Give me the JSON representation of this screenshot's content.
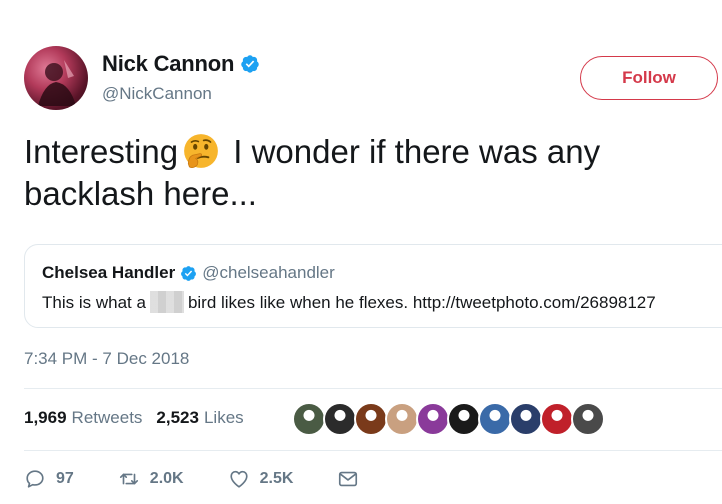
{
  "author": {
    "name": "Nick Cannon",
    "handle": "@NickCannon",
    "verified": true
  },
  "follow": {
    "label": "Follow"
  },
  "tweet": {
    "text_before_emoji": "Interesting",
    "emoji": "thinking-face",
    "text_after_emoji": " I wonder if there was any backlash here..."
  },
  "quote": {
    "name": "Chelsea Handler",
    "handle": "@chelseahandler",
    "verified": true,
    "text_before_blur": "This is what a",
    "text_after_blur": "bird likes like when he flexes.  http://tweetphoto.com/26898127"
  },
  "timestamp": "7:34 PM - 7 Dec 2018",
  "stats": {
    "retweets_count": "1,969",
    "retweets_label": "Retweets",
    "likes_count": "2,523",
    "likes_label": "Likes"
  },
  "likers": [
    {
      "color": "#4a5b44"
    },
    {
      "color": "#2b2b2b"
    },
    {
      "color": "#7a3a1a"
    },
    {
      "color": "#c9a080"
    },
    {
      "color": "#8a3a9a"
    },
    {
      "color": "#1a1a1a"
    },
    {
      "color": "#3a6aa8"
    },
    {
      "color": "#2a3e6a"
    },
    {
      "color": "#c0202a"
    },
    {
      "color": "#4a4a4a"
    }
  ],
  "actions": {
    "reply_count": "97",
    "retweet_count": "2.0K",
    "like_count": "2.5K"
  },
  "colors": {
    "accent_red": "#d4394a",
    "verified_blue": "#1da1f2",
    "muted_text": "#657786"
  }
}
